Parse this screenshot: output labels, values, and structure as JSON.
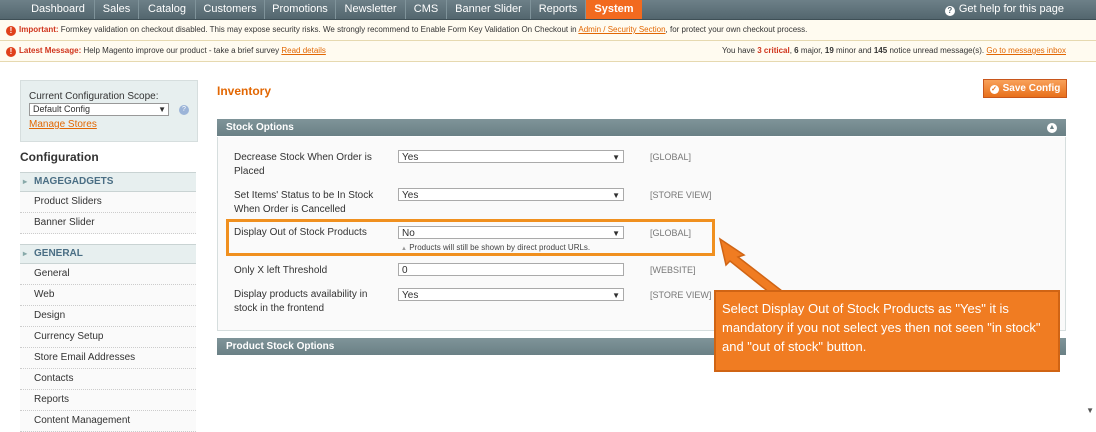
{
  "nav": {
    "items": [
      "Dashboard",
      "Sales",
      "Catalog",
      "Customers",
      "Promotions",
      "Newsletter",
      "CMS",
      "Banner Slider",
      "Reports",
      "System"
    ],
    "active": "System",
    "help": "Get help for this page"
  },
  "messages": {
    "important_label": "Important:",
    "important_text": "Formkey validation on checkout disabled. This may expose security risks. We strongly recommend to Enable Form Key Validation On Checkout in",
    "important_link": "Admin / Security Section",
    "important_tail": ", for protect your own checkout process.",
    "latest_label": "Latest Message:",
    "latest_text": "Help Magento improve our product - take a brief survey",
    "latest_link": "Read details",
    "count_prefix": "You have",
    "critical_count": "3 critical",
    "major": "6",
    "major_label": "major,",
    "minor": "19",
    "minor_label": "minor and",
    "notice": "145",
    "notice_label": "notice unread message(s).",
    "inbox_link": "Go to messages inbox"
  },
  "sidebar": {
    "scope_label": "Current Configuration Scope:",
    "scope_value": "Default Config",
    "manage_stores": "Manage Stores",
    "config_title": "Configuration",
    "groups": [
      {
        "label": "MAGEGADGETS",
        "items": [
          "Product Sliders",
          "Banner Slider"
        ]
      },
      {
        "label": "GENERAL",
        "items": [
          "General",
          "Web",
          "Design",
          "Currency Setup",
          "Store Email Addresses",
          "Contacts",
          "Reports",
          "Content Management"
        ]
      }
    ]
  },
  "main": {
    "title": "Inventory",
    "save_label": "Save Config",
    "stock_options_title": "Stock Options",
    "product_stock_options_title": "Product Stock Options",
    "rows": [
      {
        "label": "Decrease Stock When Order is Placed",
        "value": "Yes",
        "scope": "[GLOBAL]"
      },
      {
        "label": "Set Items' Status to be In Stock When Order is Cancelled",
        "value": "Yes",
        "scope": "[STORE VIEW]"
      },
      {
        "label": "Display Out of Stock Products",
        "value": "No",
        "scope": "[GLOBAL]",
        "note": "Products will still be shown by direct product URLs."
      },
      {
        "label": "Only X left Threshold",
        "value": "0",
        "scope": "[WEBSITE]"
      },
      {
        "label": "Display products availability in stock in the frontend",
        "value": "Yes",
        "scope": "[STORE VIEW]"
      }
    ]
  },
  "callout": {
    "text": "Select Display Out of Stock Products as \"Yes\" it is mandatory if you not select yes then not seen \"in stock\" and \"out of stock\" button."
  },
  "colors": {
    "accent": "#f26a1f",
    "nav": "#5d7078",
    "section": "#6a8085",
    "link": "#e26703"
  }
}
